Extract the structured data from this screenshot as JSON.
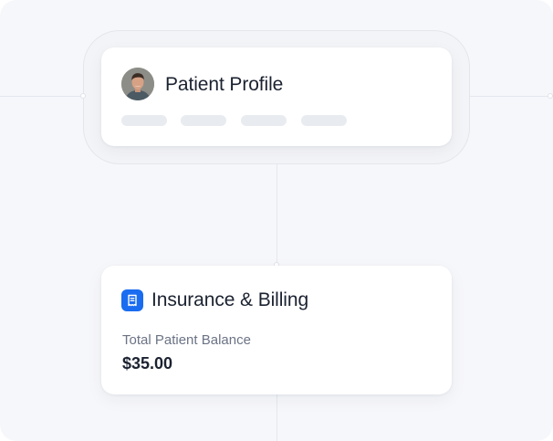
{
  "patient_profile": {
    "title": "Patient Profile",
    "avatar_icon": "user-photo-avatar"
  },
  "billing": {
    "title": "Insurance & Billing",
    "icon": "receipt-icon",
    "balance_label": "Total Patient Balance",
    "balance_value": "$35.00"
  },
  "colors": {
    "accent": "#1a6cf0",
    "text_primary": "#1b2230",
    "text_secondary": "#6b7385",
    "background": "#f6f7fa"
  }
}
